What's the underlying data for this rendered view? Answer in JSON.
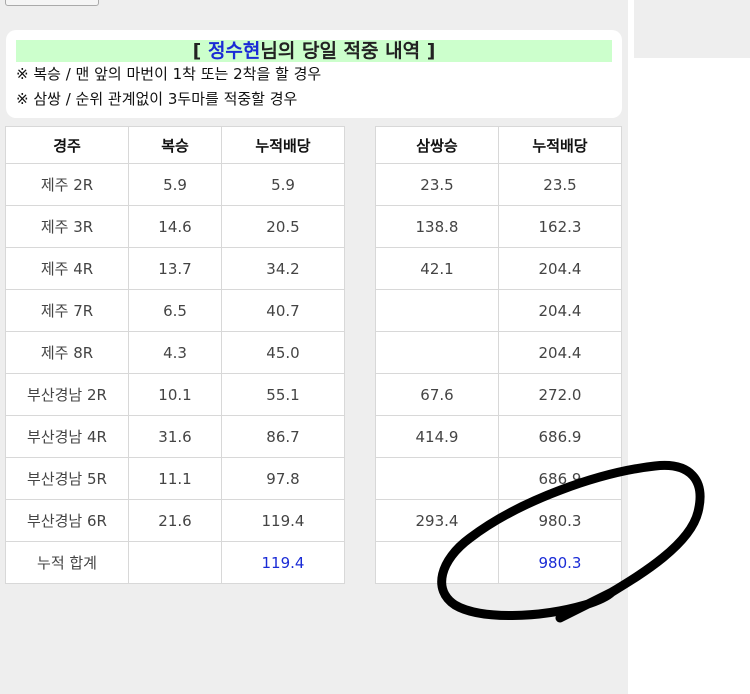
{
  "header": {
    "title_open": "[ ",
    "title_name": "정수현",
    "title_rest": "님의 당일 적중 내역 ]",
    "notes": [
      "※ 복승 / 맨 앞의 마번이 1착 또는 2착을 할 경우",
      "※ 삼쌍 / 순위 관계없이 3두마를 적중할 경우"
    ]
  },
  "left_table": {
    "columns": [
      "경주",
      "복승",
      "누적배당"
    ],
    "rows": [
      [
        "제주 2R",
        "5.9",
        "5.9"
      ],
      [
        "제주 3R",
        "14.6",
        "20.5"
      ],
      [
        "제주 4R",
        "13.7",
        "34.2"
      ],
      [
        "제주 7R",
        "6.5",
        "40.7"
      ],
      [
        "제주 8R",
        "4.3",
        "45.0"
      ],
      [
        "부산경남 2R",
        "10.1",
        "55.1"
      ],
      [
        "부산경남 4R",
        "31.6",
        "86.7"
      ],
      [
        "부산경남 5R",
        "11.1",
        "97.8"
      ],
      [
        "부산경남 6R",
        "21.6",
        "119.4"
      ]
    ],
    "total": [
      "누적 합계",
      "",
      "119.4"
    ]
  },
  "right_table": {
    "columns": [
      "삼쌍승",
      "누적배당"
    ],
    "rows": [
      [
        "23.5",
        "23.5"
      ],
      [
        "138.8",
        "162.3"
      ],
      [
        "42.1",
        "204.4"
      ],
      [
        "",
        "204.4"
      ],
      [
        "",
        "204.4"
      ],
      [
        "67.6",
        "272.0"
      ],
      [
        "414.9",
        "686.9"
      ],
      [
        "",
        "686.9"
      ],
      [
        "293.4",
        "980.3"
      ]
    ],
    "total": [
      "",
      "980.3"
    ]
  },
  "colors": {
    "title_highlight": "#ccffcc",
    "name_blue": "#1a2bd6",
    "total_blue": "#1a2bd6",
    "panel_gray": "#eeeeee"
  }
}
